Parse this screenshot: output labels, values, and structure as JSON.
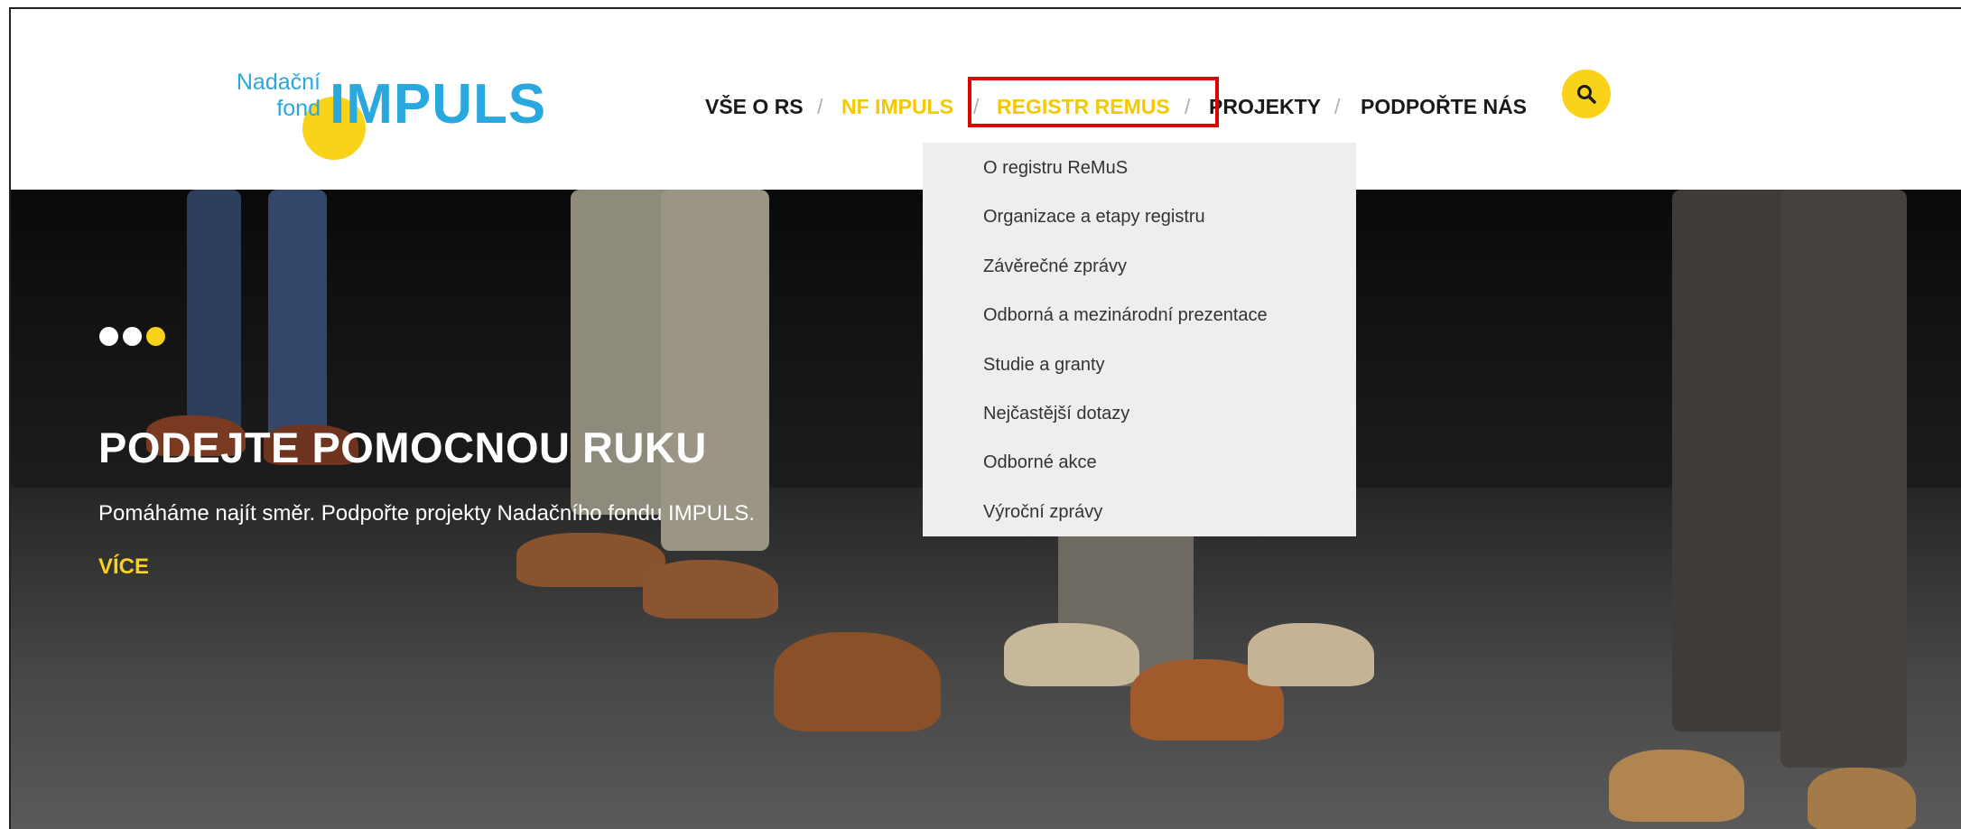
{
  "logo": {
    "small_line1": "Nadační",
    "small_line2": "fond",
    "brand": "IMPULS"
  },
  "nav": {
    "items": [
      {
        "label": "VŠE O RS"
      },
      {
        "label": "NF IMPULS"
      },
      {
        "label": "REGISTR REMUS"
      },
      {
        "label": "PROJEKTY"
      },
      {
        "label": "PODPOŘTE NÁS"
      }
    ],
    "separator": "/",
    "search_icon": "search-icon"
  },
  "dropdown": {
    "items": [
      "O registru ReMuS",
      "Organizace a etapy registru",
      "Závěrečné zprávy",
      "Odborná a mezinárodní prezentace",
      "Studie a granty",
      "Nejčastější dotazy",
      "Odborné akce",
      "Výroční zprávy"
    ]
  },
  "hero": {
    "title": "PODEJTE POMOCNOU RUKU",
    "subtitle": "Pomáháme najít směr. Podpořte projekty Nadačního fondu IMPULS.",
    "more": "VÍCE",
    "slides_total": 3,
    "slide_active": 3
  },
  "colors": {
    "accent_yellow": "#f9d21a",
    "brand_blue": "#29a8e0",
    "highlight_red": "#e10000"
  }
}
